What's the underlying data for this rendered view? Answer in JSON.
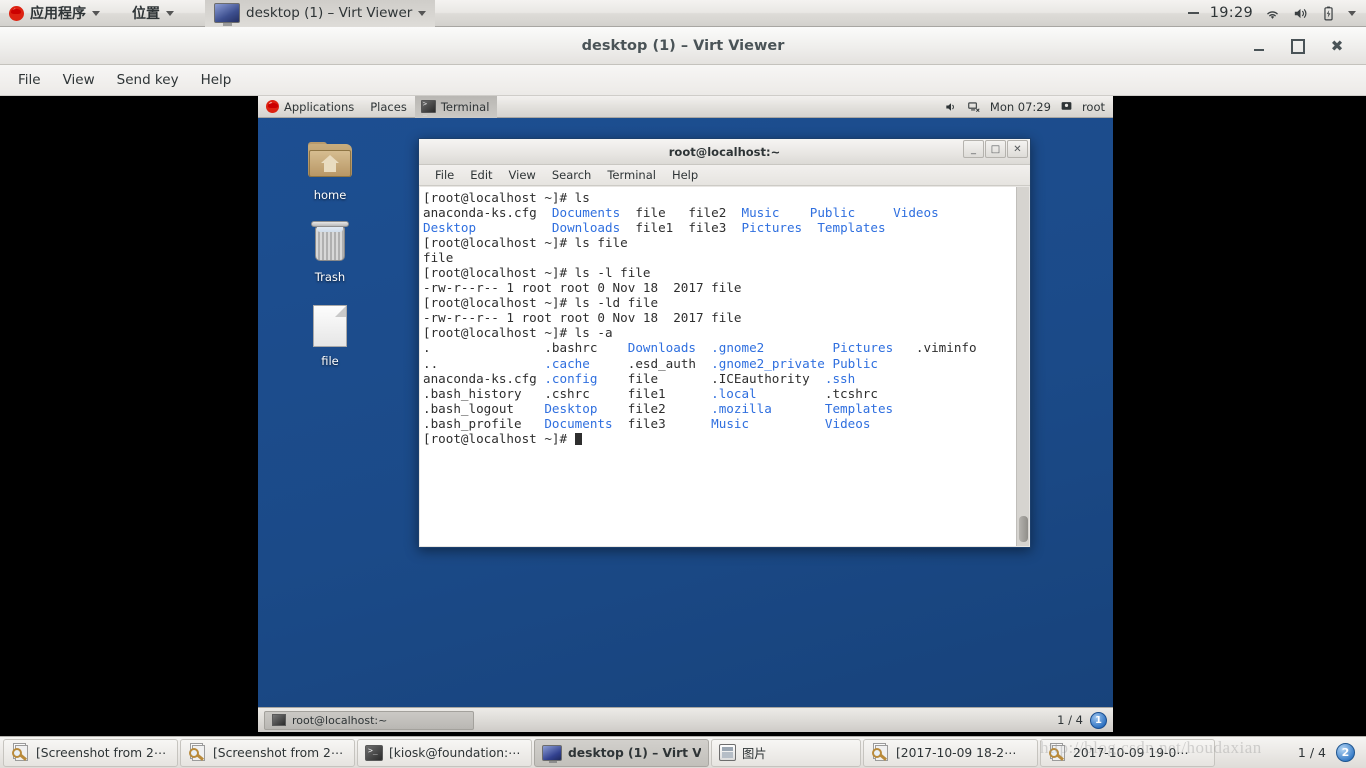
{
  "host_panel": {
    "applications_label": "应用程序",
    "places_label": "位置",
    "window_label": "desktop (1) – Virt Viewer",
    "clock": "19:29",
    "icons": [
      "wifi-icon",
      "volume-icon",
      "battery-icon",
      "chevron-down-icon"
    ]
  },
  "virt_viewer": {
    "title": "desktop (1) – Virt Viewer",
    "menus": [
      "File",
      "View",
      "Send key",
      "Help"
    ],
    "window_buttons": [
      "minimize",
      "maximize",
      "close"
    ]
  },
  "guest_panel": {
    "applications_label": "Applications",
    "places_label": "Places",
    "active_window_label": "Terminal",
    "clock": "Mon 07:29",
    "user": "root"
  },
  "desktop_icons": [
    {
      "name": "home",
      "label": "home"
    },
    {
      "name": "trash",
      "label": "Trash"
    },
    {
      "name": "file",
      "label": "file"
    }
  ],
  "terminal": {
    "title": "root@localhost:~",
    "menus": [
      "File",
      "Edit",
      "View",
      "Search",
      "Terminal",
      "Help"
    ],
    "window_buttons": [
      "_",
      "□",
      "✕"
    ],
    "lines": [
      [
        {
          "t": "[root@localhost ~]# ls",
          "c": "n"
        }
      ],
      [
        {
          "t": "anaconda-ks.cfg  ",
          "c": "n"
        },
        {
          "t": "Documents",
          "c": "b"
        },
        {
          "t": "  file   file2  ",
          "c": "n"
        },
        {
          "t": "Music",
          "c": "b"
        },
        {
          "t": "    ",
          "c": "n"
        },
        {
          "t": "Public",
          "c": "b"
        },
        {
          "t": "     ",
          "c": "n"
        },
        {
          "t": "Videos",
          "c": "b"
        }
      ],
      [
        {
          "t": "Desktop",
          "c": "b"
        },
        {
          "t": "          ",
          "c": "n"
        },
        {
          "t": "Downloads",
          "c": "b"
        },
        {
          "t": "  file1  file3  ",
          "c": "n"
        },
        {
          "t": "Pictures",
          "c": "b"
        },
        {
          "t": "  ",
          "c": "n"
        },
        {
          "t": "Templates",
          "c": "b"
        }
      ],
      [
        {
          "t": "[root@localhost ~]# ls file",
          "c": "n"
        }
      ],
      [
        {
          "t": "file",
          "c": "n"
        }
      ],
      [
        {
          "t": "[root@localhost ~]# ls -l file",
          "c": "n"
        }
      ],
      [
        {
          "t": "-rw-r--r-- 1 root root 0 Nov 18  2017 file",
          "c": "n"
        }
      ],
      [
        {
          "t": "[root@localhost ~]# ls -ld file",
          "c": "n"
        }
      ],
      [
        {
          "t": "-rw-r--r-- 1 root root 0 Nov 18  2017 file",
          "c": "n"
        }
      ],
      [
        {
          "t": "[root@localhost ~]# ls -a",
          "c": "n"
        }
      ],
      [
        {
          "t": ".               ",
          ".c": "n",
          "c": "n"
        },
        {
          "t": ".bashrc",
          "c": "n"
        },
        {
          "t": "    ",
          "c": "n"
        },
        {
          "t": "Downloads",
          "c": "b"
        },
        {
          "t": "  ",
          "c": "n"
        },
        {
          "t": ".gnome2",
          "c": "b"
        },
        {
          "t": "         ",
          "c": "n"
        },
        {
          "t": "Pictures",
          "c": "b"
        },
        {
          "t": "   .viminfo",
          "c": "n"
        }
      ],
      [
        {
          "t": "..              ",
          "c": "n"
        },
        {
          "t": ".cache",
          "c": "b"
        },
        {
          "t": "     .esd_auth  ",
          "c": "n"
        },
        {
          "t": ".gnome2_private",
          "c": "b"
        },
        {
          "t": " ",
          "c": "n"
        },
        {
          "t": "Public",
          "c": "b"
        }
      ],
      [
        {
          "t": "anaconda-ks.cfg ",
          "c": "n"
        },
        {
          "t": ".config",
          "c": "b"
        },
        {
          "t": "    file       .ICEauthority  ",
          "c": "n"
        },
        {
          "t": ".ssh",
          "c": "b"
        }
      ],
      [
        {
          "t": ".bash_history   .cshrc     file1      ",
          "c": "n"
        },
        {
          "t": ".local",
          "c": "b"
        },
        {
          "t": "         .tcshrc",
          "c": "n"
        }
      ],
      [
        {
          "t": ".bash_logout    ",
          "c": "n"
        },
        {
          "t": "Desktop",
          "c": "b"
        },
        {
          "t": "    file2      ",
          "c": "n"
        },
        {
          "t": ".mozilla",
          "c": "b"
        },
        {
          "t": "       ",
          "c": "n"
        },
        {
          "t": "Templates",
          "c": "b"
        }
      ],
      [
        {
          "t": ".bash_profile   ",
          "c": "n"
        },
        {
          "t": "Documents",
          "c": "b"
        },
        {
          "t": "  file3      ",
          "c": "n"
        },
        {
          "t": "Music",
          "c": "b"
        },
        {
          "t": "          ",
          "c": "n"
        },
        {
          "t": "Videos",
          "c": "b"
        }
      ],
      [
        {
          "t": "[root@localhost ~]# ",
          "c": "n"
        },
        {
          "t": "CURSOR",
          "c": "cur"
        }
      ]
    ]
  },
  "guest_taskbar": {
    "window_label": "root@localhost:~",
    "workspace_text": "1 / 4",
    "workspace_badge": "1"
  },
  "host_taskbar": {
    "items": [
      {
        "icon": "screenshot-icon",
        "label": "[Screenshot from 2⋯",
        "active": false
      },
      {
        "icon": "screenshot-icon",
        "label": "[Screenshot from 2⋯",
        "active": false
      },
      {
        "icon": "terminal-icon",
        "label": "[kiosk@foundation:⋯",
        "active": false
      },
      {
        "icon": "virt-viewer-icon",
        "label": "desktop (1) – Virt V⋯",
        "active": true
      },
      {
        "icon": "picture-icon",
        "label": "图片",
        "active": false
      },
      {
        "icon": "screenshot-icon",
        "label": "[2017-10-09 18-2⋯",
        "active": false
      },
      {
        "icon": "screenshot-icon",
        "label": "2017-10-09 19-0⋯",
        "active": false
      }
    ],
    "workspace_text": "1 / 4",
    "workspace_badge": "2"
  },
  "watermark": "http://blog.csdn.net/houdaxian",
  "colors": {
    "desktop_blue": "#1c4f8f",
    "terminal_dir_blue": "#2f6fdf",
    "panel_grey": "#e3e1dd"
  }
}
